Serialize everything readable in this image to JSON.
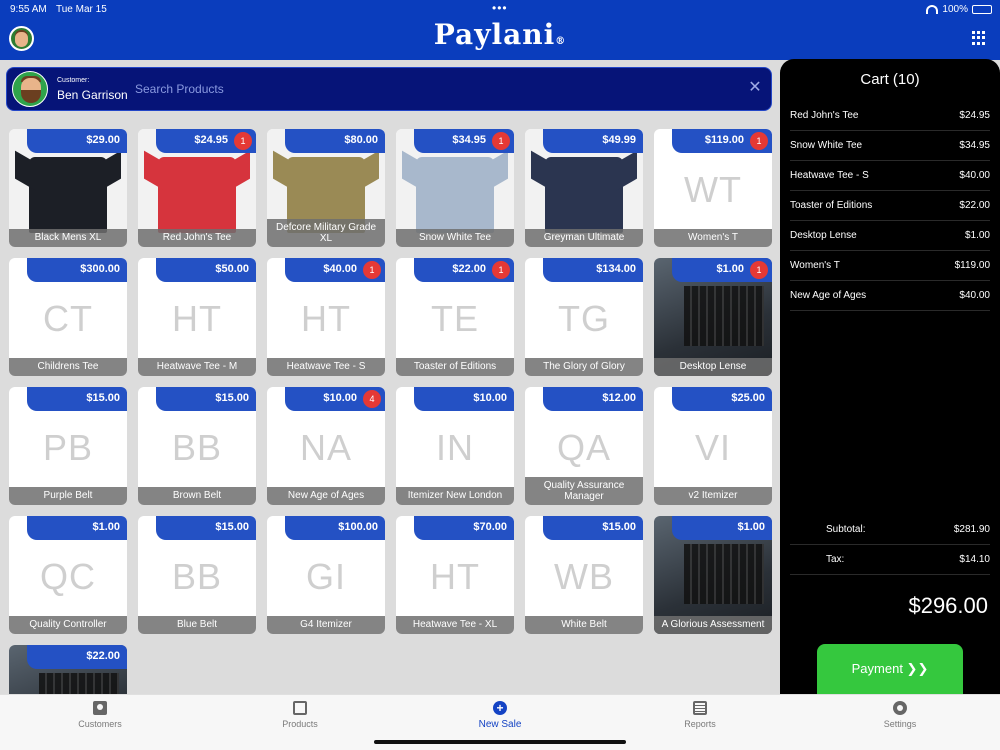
{
  "status_bar": {
    "time": "9:55 AM",
    "date": "Tue Mar 15",
    "battery": "100%"
  },
  "header": {
    "logo": "Paylani",
    "logo_mark": "®"
  },
  "customer": {
    "label": "Customer:",
    "name": "Ben Garrison"
  },
  "search": {
    "placeholder": "Search Products"
  },
  "products": [
    {
      "name": "Black Mens XL",
      "price": "$29.00",
      "initials": "",
      "badge": "",
      "image": "shirt-black"
    },
    {
      "name": "Red John's Tee",
      "price": "$24.95",
      "initials": "",
      "badge": "1",
      "image": "shirt-red"
    },
    {
      "name": "Defcore Military Grade XL",
      "price": "$80.00",
      "initials": "",
      "badge": "",
      "image": "shirt-olive"
    },
    {
      "name": "Snow White Tee",
      "price": "$34.95",
      "initials": "",
      "badge": "1",
      "image": "shirt-grey"
    },
    {
      "name": "Greyman Ultimate",
      "price": "$49.99",
      "initials": "",
      "badge": "",
      "image": "shirt-navy"
    },
    {
      "name": "Women's T",
      "price": "$119.00",
      "initials": "WT",
      "badge": "1",
      "image": ""
    },
    {
      "name": "Childrens Tee",
      "price": "$300.00",
      "initials": "CT",
      "badge": "",
      "image": ""
    },
    {
      "name": "Heatwave Tee - M",
      "price": "$50.00",
      "initials": "HT",
      "badge": "",
      "image": ""
    },
    {
      "name": "Heatwave Tee - S",
      "price": "$40.00",
      "initials": "HT",
      "badge": "1",
      "image": ""
    },
    {
      "name": "Toaster of Editions",
      "price": "$22.00",
      "initials": "TE",
      "badge": "1",
      "image": ""
    },
    {
      "name": "The Glory of Glory",
      "price": "$134.00",
      "initials": "TG",
      "badge": "",
      "image": ""
    },
    {
      "name": "Desktop Lense",
      "price": "$1.00",
      "initials": "",
      "badge": "1",
      "image": "laptop"
    },
    {
      "name": "Purple Belt",
      "price": "$15.00",
      "initials": "PB",
      "badge": "",
      "image": ""
    },
    {
      "name": "Brown Belt",
      "price": "$15.00",
      "initials": "BB",
      "badge": "",
      "image": ""
    },
    {
      "name": "New Age of Ages",
      "price": "$10.00",
      "initials": "NA",
      "badge": "4",
      "image": ""
    },
    {
      "name": "Itemizer New London",
      "price": "$10.00",
      "initials": "IN",
      "badge": "",
      "image": ""
    },
    {
      "name": "Quality Assurance Manager",
      "price": "$12.00",
      "initials": "QA",
      "badge": "",
      "image": ""
    },
    {
      "name": "v2 Itemizer",
      "price": "$25.00",
      "initials": "VI",
      "badge": "",
      "image": ""
    },
    {
      "name": "Quality Controller",
      "price": "$1.00",
      "initials": "QC",
      "badge": "",
      "image": ""
    },
    {
      "name": "Blue Belt",
      "price": "$15.00",
      "initials": "BB",
      "badge": "",
      "image": ""
    },
    {
      "name": "G4 Itemizer",
      "price": "$100.00",
      "initials": "GI",
      "badge": "",
      "image": ""
    },
    {
      "name": "Heatwave Tee - XL",
      "price": "$70.00",
      "initials": "HT",
      "badge": "",
      "image": ""
    },
    {
      "name": "White Belt",
      "price": "$15.00",
      "initials": "WB",
      "badge": "",
      "image": ""
    },
    {
      "name": "A Glorious Assessment",
      "price": "$1.00",
      "initials": "",
      "badge": "",
      "image": "laptop"
    },
    {
      "name": "",
      "price": "$22.00",
      "initials": "",
      "badge": "",
      "image": "laptop"
    }
  ],
  "cart": {
    "title": "Cart (10)",
    "items": [
      {
        "name": "Red John's Tee",
        "price": "$24.95"
      },
      {
        "name": "Snow White Tee",
        "price": "$34.95"
      },
      {
        "name": "Heatwave Tee - S",
        "price": "$40.00"
      },
      {
        "name": "Toaster of Editions",
        "price": "$22.00"
      },
      {
        "name": "Desktop Lense",
        "price": "$1.00"
      },
      {
        "name": "Women's T",
        "price": "$119.00"
      },
      {
        "name": "New Age of Ages",
        "price": "$40.00"
      }
    ],
    "subtotal_label": "Subtotal:",
    "subtotal": "$281.90",
    "tax_label": "Tax:",
    "tax": "$14.10",
    "total": "$296.00",
    "payment_label": "Payment ❯❯"
  },
  "tabs": [
    {
      "label": "Customers",
      "icon": "person-icon"
    },
    {
      "label": "Products",
      "icon": "box-icon"
    },
    {
      "label": "New Sale",
      "icon": "plus-icon"
    },
    {
      "label": "Reports",
      "icon": "list-icon"
    },
    {
      "label": "Settings",
      "icon": "gear-icon"
    }
  ],
  "colors": {
    "header_blue": "#0a3dbd",
    "price_tag_blue": "#2451c4",
    "badge_red": "#e53935",
    "payment_green": "#35c83e",
    "active_tab": "#1443c4"
  }
}
